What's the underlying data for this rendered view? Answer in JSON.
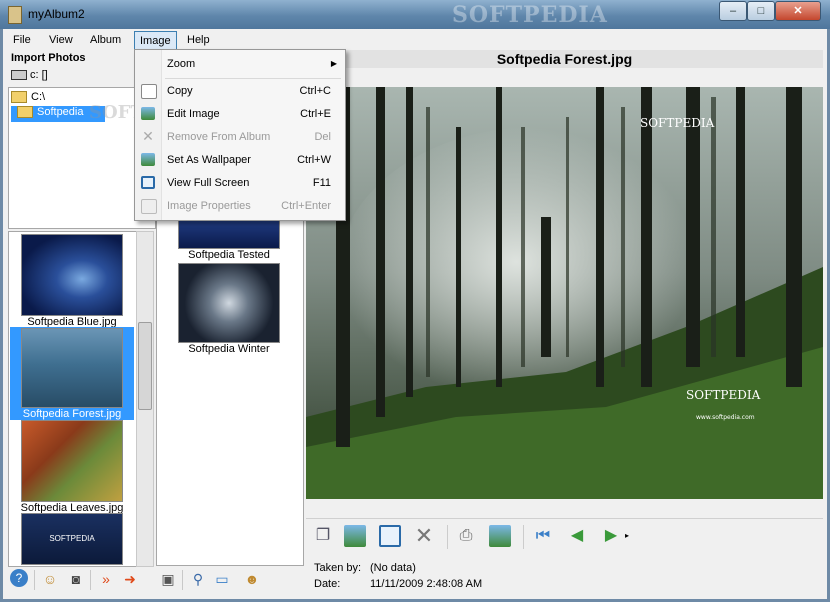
{
  "window": {
    "title": "myAlbum2",
    "watermark": "SOFTPEDIA",
    "controls": {
      "minimize": "–",
      "maximize": "□",
      "close": "✕"
    }
  },
  "menu": {
    "file": "File",
    "view": "View",
    "album": "Album",
    "image": "Image",
    "help": "Help"
  },
  "left_panel": {
    "import_label": "Import Photos",
    "drive": "c: []",
    "tree": [
      {
        "label": "C:\\"
      },
      {
        "label": "Softpedia"
      }
    ],
    "tree_watermark": "SOFTPEDIA"
  },
  "thumbnails_left": [
    {
      "label": "Softpedia Blue.jpg"
    },
    {
      "label": "Softpedia Forest.jpg"
    },
    {
      "label": "Softpedia Leaves.jpg"
    },
    {
      "label": "SOFTPEDIA"
    }
  ],
  "thumbnails_right": [
    {
      "label": "Softpedia Tested"
    },
    {
      "label": "Softpedia Winter"
    }
  ],
  "image_view": {
    "title": "Softpedia Forest.jpg",
    "watermark_top": "SOFTPEDIA",
    "watermark_mid": "SOFTPEDIA",
    "watermark_url": "www.softpedia.com"
  },
  "info": {
    "taken_by_label": "Taken by:",
    "taken_by_value": "(No data)",
    "date_label": "Date:",
    "date_value": "11/11/2009 2:48:08 AM"
  },
  "image_menu": {
    "items": [
      {
        "label": "Zoom",
        "shortcut": "",
        "submenu": true,
        "disabled": false,
        "icon": ""
      },
      {
        "label": "Copy",
        "shortcut": "Ctrl+C",
        "disabled": false,
        "icon": "copy-icon"
      },
      {
        "label": "Edit Image",
        "shortcut": "Ctrl+E",
        "disabled": false,
        "icon": "edit-image-icon"
      },
      {
        "label": "Remove From Album",
        "shortcut": "Del",
        "disabled": true,
        "icon": "remove-icon"
      },
      {
        "label": "Set As Wallpaper",
        "shortcut": "Ctrl+W",
        "disabled": false,
        "icon": "wallpaper-icon"
      },
      {
        "label": "View Full Screen",
        "shortcut": "F11",
        "disabled": false,
        "icon": "fullscreen-icon"
      },
      {
        "label": "Image Properties",
        "shortcut": "Ctrl+Enter",
        "disabled": true,
        "icon": "properties-icon"
      }
    ]
  },
  "colors": {
    "selection": "#3399ff",
    "titlebar": "#5f86ab",
    "menu_hover": "#dbe9f7"
  }
}
